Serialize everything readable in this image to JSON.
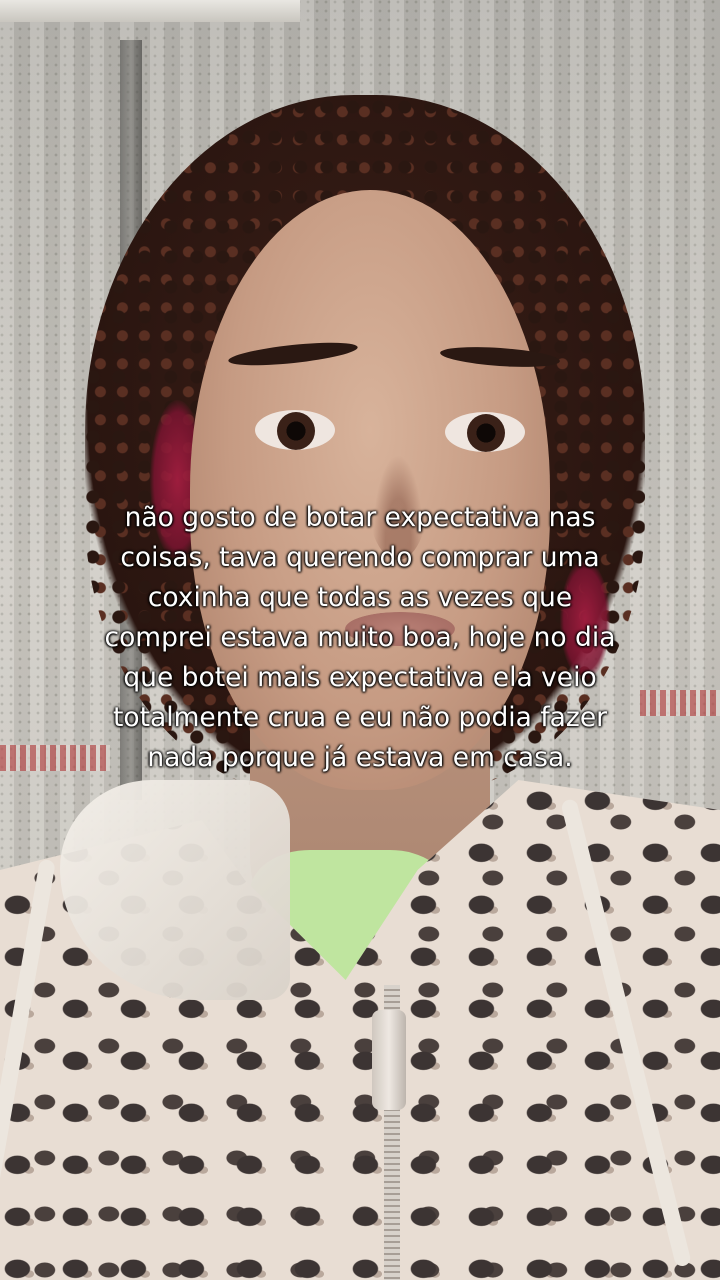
{
  "caption": {
    "lines": [
      "não gosto de botar expectativa nas",
      "coisas, tava querendo comprar uma",
      "coxinha que todas as vezes que",
      "comprei estava muito boa, hoje no dia",
      "que botei mais expectativa ela veio",
      "totalmente crua e eu não podia fazer",
      "nada porque já estava em casa."
    ]
  },
  "colors": {
    "caption_text": "#ffffff",
    "hair": "#2a1510",
    "hair_highlight": "#b01e45",
    "shirt": "#bfe59f",
    "hoodie_base": "#e8ddd3",
    "leopard_spot": "#3c3433"
  }
}
